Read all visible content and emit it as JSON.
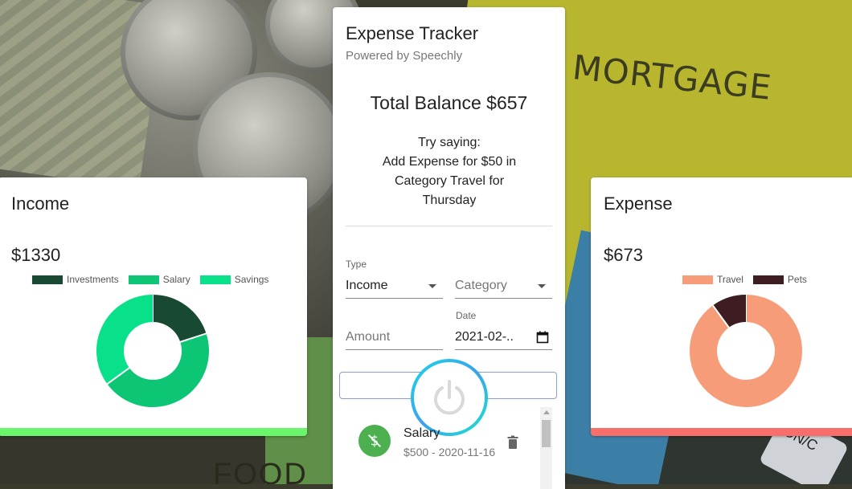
{
  "income": {
    "title": "Income",
    "amount": "$1330",
    "legend": [
      {
        "label": "Investments",
        "color": "#184a33"
      },
      {
        "label": "Salary",
        "color": "#0cc575"
      },
      {
        "label": "Savings",
        "color": "#08e189"
      }
    ],
    "slices": [
      0.2,
      0.45,
      0.35
    ],
    "bar_color": "#6bf56b"
  },
  "expense": {
    "title": "Expense",
    "amount": "$673",
    "legend": [
      {
        "label": "Travel",
        "color": "#f79c79"
      },
      {
        "label": "Pets",
        "color": "#3d1c22"
      }
    ],
    "slices": [
      0.9,
      0.1
    ],
    "bar_color": "#f86e6a"
  },
  "tracker": {
    "title": "Expense Tracker",
    "subtitle": "Powered by Speechly",
    "balance": "Total Balance $657",
    "hint": [
      "Try saying:",
      "Add Expense for $50 in",
      "Category Travel for",
      "Thursday"
    ],
    "type_label": "Type",
    "type_value": "Income",
    "category_placeholder": "Category",
    "amount_placeholder": "Amount",
    "date_label": "Date",
    "date_value": "2021-02-..",
    "transactions": [
      {
        "title": "Salary",
        "detail": "$500 - 2020-11-16",
        "icon": "money-off-icon",
        "color": "#4caf50"
      }
    ]
  },
  "background": {
    "word1": "MORTGAGE",
    "word2": "FOOD",
    "key_text": "ON/C"
  }
}
